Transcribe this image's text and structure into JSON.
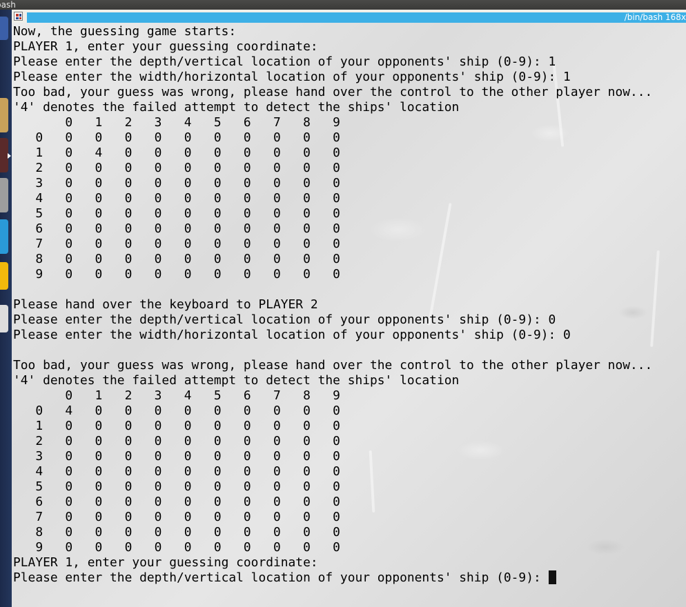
{
  "top_panel": {
    "title": "bash"
  },
  "terminal": {
    "tab_title": "/bin/bash 168x",
    "lines": [
      "Now, the guessing game starts:",
      "PLAYER 1, enter your guessing coordinate:",
      "Please enter the depth/vertical location of your opponents' ship (0-9): 1",
      "Please enter the width/horizontal location of your opponents' ship (0-9): 1",
      "Too bad, your guess was wrong, please hand over the control to the other player now...",
      "'4' denotes the failed attempt to detect the ships' location",
      "       0   1   2   3   4   5   6   7   8   9",
      "   0   0   0   0   0   0   0   0   0   0   0",
      "   1   0   4   0   0   0   0   0   0   0   0",
      "   2   0   0   0   0   0   0   0   0   0   0",
      "   3   0   0   0   0   0   0   0   0   0   0",
      "   4   0   0   0   0   0   0   0   0   0   0",
      "   5   0   0   0   0   0   0   0   0   0   0",
      "   6   0   0   0   0   0   0   0   0   0   0",
      "   7   0   0   0   0   0   0   0   0   0   0",
      "   8   0   0   0   0   0   0   0   0   0   0",
      "   9   0   0   0   0   0   0   0   0   0   0",
      "",
      "Please hand over the keyboard to PLAYER 2",
      "Please enter the depth/vertical location of your opponents' ship (0-9): 0",
      "Please enter the width/horizontal location of your opponents' ship (0-9): 0",
      "",
      "Too bad, your guess was wrong, please hand over the control to the other player now...",
      "'4' denotes the failed attempt to detect the ships' location",
      "       0   1   2   3   4   5   6   7   8   9",
      "   0   4   0   0   0   0   0   0   0   0   0",
      "   1   0   0   0   0   0   0   0   0   0   0",
      "   2   0   0   0   0   0   0   0   0   0   0",
      "   3   0   0   0   0   0   0   0   0   0   0",
      "   4   0   0   0   0   0   0   0   0   0   0",
      "   5   0   0   0   0   0   0   0   0   0   0",
      "   6   0   0   0   0   0   0   0   0   0   0",
      "   7   0   0   0   0   0   0   0   0   0   0",
      "   8   0   0   0   0   0   0   0   0   0   0",
      "   9   0   0   0   0   0   0   0   0   0   0",
      "PLAYER 1, enter your guessing coordinate:"
    ],
    "prompt_line": "Please enter the depth/vertical location of your opponents' ship (0-9): "
  },
  "launcher": {
    "items": [
      "dash-home-icon",
      "files-icon",
      "app-icon",
      "terminal-icon",
      "app-icon",
      "app-icon",
      "app-icon",
      "app-icon"
    ],
    "colors": [
      "#3b5fa8",
      "#c8a15a",
      "#9a6a3a",
      "#5a2a2a",
      "#9e9e9e",
      "#2a9ad8",
      "#f2b90c",
      "#dddddd"
    ]
  }
}
